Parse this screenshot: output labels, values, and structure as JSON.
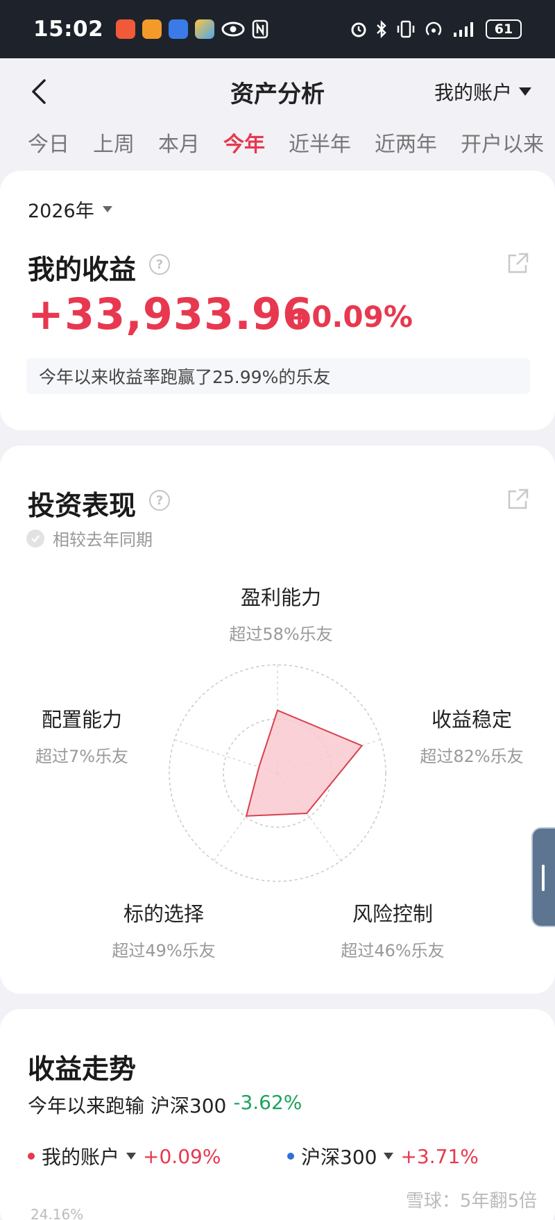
{
  "status_bar": {
    "time": "15:02",
    "battery": "61",
    "app_icons": [
      "bank-app-icon",
      "chat-app-icon",
      "browser-app-icon",
      "game-app-icon"
    ],
    "system_icons": [
      "eye-icon",
      "nfc-icon",
      "alarm-icon",
      "bluetooth-icon",
      "vibrate-icon",
      "hotspot-icon",
      "signal-icon"
    ]
  },
  "header": {
    "title": "资产分析",
    "account_label": "我的账户"
  },
  "tabs": [
    {
      "label": "今日",
      "active": false
    },
    {
      "label": "上周",
      "active": false
    },
    {
      "label": "本月",
      "active": false
    },
    {
      "label": "今年",
      "active": true
    },
    {
      "label": "近半年",
      "active": false
    },
    {
      "label": "近两年",
      "active": false
    },
    {
      "label": "开户以来",
      "active": false
    }
  ],
  "earnings": {
    "year": "2026年",
    "title": "我的收益",
    "amount": "+33,933.96",
    "percent": "+0.09%",
    "beat_text": "今年以来收益率跑赢了25.99%的乐友"
  },
  "performance": {
    "title": "投资表现",
    "compare_label": "相较去年同期",
    "radar": [
      {
        "name": "盈利能力",
        "sub": "超过58%乐友",
        "value": 0.58
      },
      {
        "name": "收益稳定",
        "sub": "超过82%乐友",
        "value": 0.82
      },
      {
        "name": "风险控制",
        "sub": "超过46%乐友",
        "value": 0.46
      },
      {
        "name": "标的选择",
        "sub": "超过49%乐友",
        "value": 0.49
      },
      {
        "name": "配置能力",
        "sub": "超过7%乐友",
        "value": 0.07
      }
    ]
  },
  "trend": {
    "title": "收益走势",
    "summary_prefix": "今年以来跑输 沪深300",
    "summary_value": "-3.62%",
    "legend": [
      {
        "name": "我的账户",
        "value": "+0.09%",
        "color": "#e8384f"
      },
      {
        "name": "沪深300",
        "value": "+3.71%",
        "color": "#2f6fd6"
      }
    ],
    "y_top_tick": "24.16%",
    "watermark": "雪球：5年翻5倍"
  },
  "colors": {
    "accent_red": "#e8384f",
    "accent_green": "#1aa35a",
    "radar_fill": "#f9c9cf",
    "radar_stroke": "#d9404f"
  }
}
